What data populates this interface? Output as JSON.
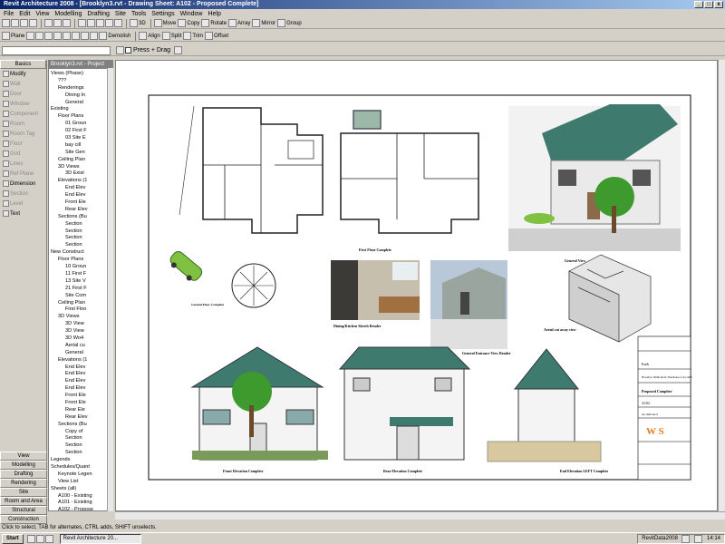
{
  "window": {
    "title": "Revit Architecture 2008 - [Brooklyn3.rvt - Drawing Sheet: A102 - Proposed Complete]",
    "controls": [
      "_",
      "□",
      "x"
    ]
  },
  "menu": [
    "File",
    "Edit",
    "View",
    "Modelling",
    "Drafting",
    "Site",
    "Tools",
    "Settings",
    "Window",
    "Help"
  ],
  "toolbar1": {
    "items": [
      "3D",
      "Move",
      "Copy",
      "Rotate",
      "Array",
      "Mirror",
      "Group"
    ]
  },
  "toolbar2": {
    "items": [
      "Plane",
      "Demolish",
      "Align",
      "Split",
      "Trim",
      "Offset"
    ]
  },
  "toolbar3": {
    "press_drag": "Press + Drag"
  },
  "designbar": {
    "active_tab": "Basics",
    "items": [
      {
        "label": "Modify",
        "enabled": true
      },
      {
        "label": "Wall",
        "enabled": false
      },
      {
        "label": "Door",
        "enabled": false
      },
      {
        "label": "Window",
        "enabled": false
      },
      {
        "label": "Component",
        "enabled": false
      },
      {
        "label": "Room",
        "enabled": false
      },
      {
        "label": "Room Tag",
        "enabled": false
      },
      {
        "label": "Floor",
        "enabled": false
      },
      {
        "label": "Grid",
        "enabled": false
      },
      {
        "label": "Lines",
        "enabled": false
      },
      {
        "label": "Ref Plane",
        "enabled": false
      },
      {
        "label": "Dimension",
        "enabled": true
      },
      {
        "label": "Section",
        "enabled": false
      },
      {
        "label": "Level",
        "enabled": false
      },
      {
        "label": "Text",
        "enabled": true
      }
    ],
    "bottom_tabs": [
      "View",
      "Modelling",
      "Drafting",
      "Rendering",
      "Site",
      "Room and Area",
      "Structural",
      "Construction"
    ]
  },
  "browser": {
    "title": "Brooklyn3.rvt - Project Browser",
    "nodes": [
      "Views (Phase)",
      "???",
      "Renderings",
      "Dining In",
      "General",
      "Existing",
      "Floor Plans",
      "01 Groun",
      "02 First F",
      "03 Site E",
      "bay cill",
      "Site Gen",
      "Ceiling Plan",
      "3D Views",
      "3D Exist",
      "Elevations (1",
      "End Elev",
      "End Elev",
      "Front Ele",
      "Rear Elev",
      "Sections (Bu",
      "Section",
      "Section",
      "Section",
      "Section",
      "New Construct",
      "Floor Plans",
      "10 Groun",
      "11 First F",
      "13 Site V",
      "21 First F",
      "Site Com",
      "Ceiling Plan",
      "First Floo",
      "3D Views",
      "3D View",
      "3D View",
      "3D Wo4",
      "Aerial cu",
      "General",
      "Elevations (1",
      "End Elev",
      "End Elev",
      "End Elev",
      "End Elev",
      "Front Ele",
      "Front Ele",
      "Rear Ele",
      "Rear Elev",
      "Sections (Bu",
      "Copy of",
      "Section",
      "Section",
      "Section",
      "Legends",
      "Schedules/Quant",
      "Keynote Legen",
      "View List",
      "Sheets (all)",
      "A100 - Existing",
      "A101 - Existing",
      "A102 - Propose"
    ]
  },
  "sheet": {
    "view_labels": [
      "Ground Floor Complete",
      "First Floor Complete",
      "General View",
      "Dining/Kitchen Sketch Render",
      "General Entrance View Render",
      "Aerial cut away view",
      "Front Elevation Complete",
      "Rear Elevation Complete",
      "End Elevation LEFT Complete"
    ],
    "title_block": {
      "logo": "W S",
      "project": "Brooklyn, Smith Road, Warehouse, Lucy AB1",
      "drawing_title": "Proposed Complete",
      "sheet_number": "A102",
      "scale": "As indicated",
      "client": "Kath"
    }
  },
  "status": "Click to select, TAB for alternates, CTRL adds, SHIFT unselects.",
  "taskbar": {
    "start": "Start",
    "task": "Revit Architecture 20...",
    "tray_text": "RevitData2008",
    "clock": "14:14"
  },
  "colors": {
    "titlebar": "#0a246a",
    "chrome": "#d4d0c8",
    "roof": "#3f7a6e",
    "tree": "#3e9a2c",
    "car": "#7fc242"
  }
}
